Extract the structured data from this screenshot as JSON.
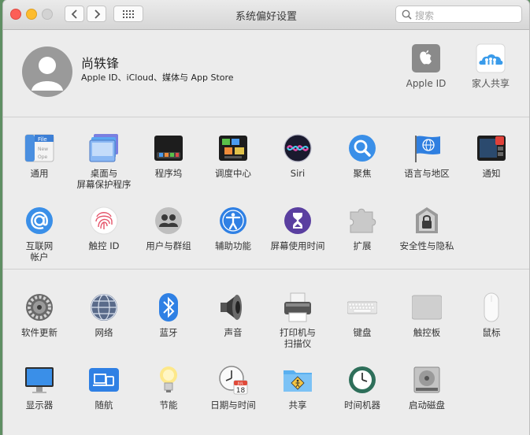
{
  "window": {
    "title": "系统偏好设置",
    "search_placeholder": "搜索",
    "traffic_lights": {
      "close": "#fc5f57",
      "minimize": "#fdbc2e",
      "zoom": "#d3d3d3"
    }
  },
  "profile": {
    "name": "尚轶锋",
    "subtitle": "Apple ID、iCloud、媒体与 App Store",
    "apple_id_label": "Apple ID",
    "family_label": "家人共享"
  },
  "row1": [
    {
      "label": "通用",
      "icon": "general-icon"
    },
    {
      "label": "桌面与\n屏幕保护程序",
      "icon": "desktop-icon"
    },
    {
      "label": "程序坞",
      "icon": "dock-icon"
    },
    {
      "label": "调度中心",
      "icon": "mission-control-icon"
    },
    {
      "label": "Siri",
      "icon": "siri-icon"
    },
    {
      "label": "聚焦",
      "icon": "spotlight-icon"
    },
    {
      "label": "语言与地区",
      "icon": "language-icon"
    },
    {
      "label": "通知",
      "icon": "notifications-icon"
    }
  ],
  "row2": [
    {
      "label": "互联网\n帐户",
      "icon": "internet-accounts-icon"
    },
    {
      "label": "触控 ID",
      "icon": "touch-id-icon"
    },
    {
      "label": "用户与群组",
      "icon": "users-icon"
    },
    {
      "label": "辅助功能",
      "icon": "accessibility-icon"
    },
    {
      "label": "屏幕使用时间",
      "icon": "screen-time-icon"
    },
    {
      "label": "扩展",
      "icon": "extensions-icon"
    },
    {
      "label": "安全性与隐私",
      "icon": "security-icon"
    }
  ],
  "row3": [
    {
      "label": "软件更新",
      "icon": "software-update-icon"
    },
    {
      "label": "网络",
      "icon": "network-icon"
    },
    {
      "label": "蓝牙",
      "icon": "bluetooth-icon"
    },
    {
      "label": "声音",
      "icon": "sound-icon"
    },
    {
      "label": "打印机与\n扫描仪",
      "icon": "printer-icon"
    },
    {
      "label": "键盘",
      "icon": "keyboard-icon"
    },
    {
      "label": "触控板",
      "icon": "trackpad-icon"
    },
    {
      "label": "鼠标",
      "icon": "mouse-icon"
    }
  ],
  "row4": [
    {
      "label": "显示器",
      "icon": "display-icon"
    },
    {
      "label": "随航",
      "icon": "sidecar-icon"
    },
    {
      "label": "节能",
      "icon": "energy-saver-icon"
    },
    {
      "label": "日期与时间",
      "icon": "date-time-icon",
      "calendar_month": "JUL",
      "calendar_day": "18"
    },
    {
      "label": "共享",
      "icon": "sharing-icon"
    },
    {
      "label": "时间机器",
      "icon": "time-machine-icon"
    },
    {
      "label": "启动磁盘",
      "icon": "startup-disk-icon"
    }
  ]
}
